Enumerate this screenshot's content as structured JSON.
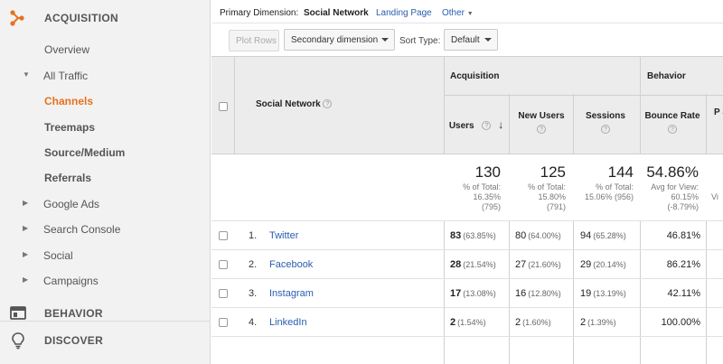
{
  "sidebar": {
    "acquisition_label": "ACQUISITION",
    "items": [
      {
        "label": "Overview"
      },
      {
        "label": "All Traffic"
      },
      {
        "label": "Channels"
      },
      {
        "label": "Treemaps"
      },
      {
        "label": "Source/Medium"
      },
      {
        "label": "Referrals"
      },
      {
        "label": "Google Ads"
      },
      {
        "label": "Search Console"
      },
      {
        "label": "Social"
      },
      {
        "label": "Campaigns"
      }
    ],
    "behavior_label": "BEHAVIOR",
    "discover_label": "DISCOVER"
  },
  "toolbar": {
    "primary_dimension_label": "Primary Dimension:",
    "dimensions": [
      {
        "label": "Social Network"
      },
      {
        "label": "Landing Page"
      },
      {
        "label": "Other"
      }
    ],
    "plot_rows_label": "Plot Rows",
    "secondary_dimension_label": "Secondary dimension",
    "sort_type_label": "Sort Type:",
    "sort_type_value": "Default"
  },
  "table": {
    "dimension_header": "Social Network",
    "groups": {
      "acquisition": "Acquisition",
      "behavior": "Behavior"
    },
    "columns": {
      "users": "Users",
      "new_users": "New Users",
      "sessions": "Sessions",
      "bounce_rate": "Bounce Rate",
      "partial": "P S"
    },
    "totals": {
      "users": {
        "value": "130",
        "sub1": "% of Total:",
        "sub2": "16.35%",
        "sub3": "(795)"
      },
      "new_users": {
        "value": "125",
        "sub1": "% of Total:",
        "sub2": "15.80%",
        "sub3": "(791)"
      },
      "sessions": {
        "value": "144",
        "sub1": "% of Total:",
        "sub2": "15.06% (956)"
      },
      "bounce_rate": {
        "value": "54.86%",
        "sub1": "Avg for View:",
        "sub2": "60.15%",
        "sub3": "(-8.79%)"
      },
      "partial": {
        "value": "Vi"
      }
    },
    "rows": [
      {
        "index": "1.",
        "name": "Twitter",
        "users": "83",
        "users_pct": "(63.85%)",
        "new_users": "80",
        "new_users_pct": "(64.00%)",
        "sessions": "94",
        "sessions_pct": "(65.28%)",
        "bounce_rate": "46.81%"
      },
      {
        "index": "2.",
        "name": "Facebook",
        "users": "28",
        "users_pct": "(21.54%)",
        "new_users": "27",
        "new_users_pct": "(21.60%)",
        "sessions": "29",
        "sessions_pct": "(20.14%)",
        "bounce_rate": "86.21%"
      },
      {
        "index": "3.",
        "name": "Instagram",
        "users": "17",
        "users_pct": "(13.08%)",
        "new_users": "16",
        "new_users_pct": "(12.80%)",
        "sessions": "19",
        "sessions_pct": "(13.19%)",
        "bounce_rate": "42.11%"
      },
      {
        "index": "4.",
        "name": "LinkedIn",
        "users": "2",
        "users_pct": "(1.54%)",
        "new_users": "2",
        "new_users_pct": "(1.60%)",
        "sessions": "2",
        "sessions_pct": "(1.39%)",
        "bounce_rate": "100.00%"
      }
    ]
  },
  "colors": {
    "accent": "#e8711c",
    "link": "#2a5db0"
  }
}
